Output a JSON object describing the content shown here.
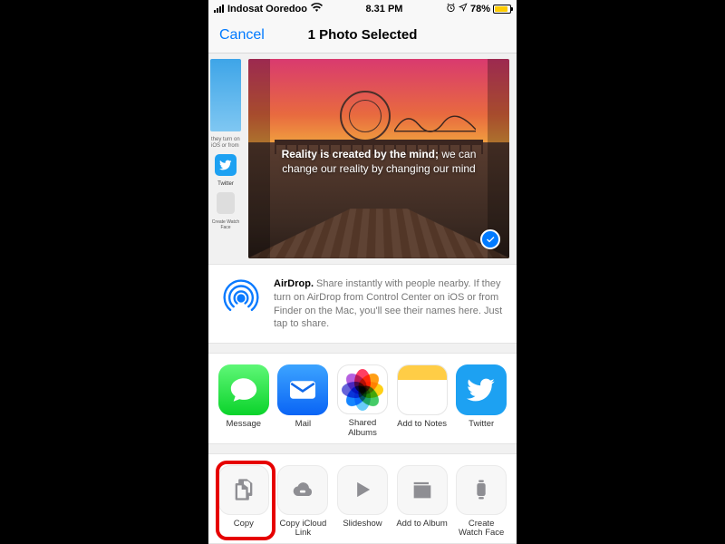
{
  "status": {
    "carrier": "Indosat Ooredoo",
    "time": "8.31 PM",
    "battery": "78%"
  },
  "nav": {
    "cancel": "Cancel",
    "title": "1 Photo Selected"
  },
  "preview": {
    "overlay_bold": "Reality is created by the mind;",
    "overlay_rest": " we can change our reality by changing our mind",
    "strip_twitter": "Twitter",
    "strip_watch": "Create Watch Face"
  },
  "airdrop": {
    "label": "AirDrop.",
    "desc": " Share instantly with people nearby. If they turn on AirDrop from Control Center on iOS or from Finder on the Mac, you'll see their names here. Just tap to share."
  },
  "apps": {
    "message": "Message",
    "mail": "Mail",
    "shared": "Shared Albums",
    "notes": "Add to Notes",
    "twitter": "Twitter"
  },
  "actions": {
    "copy": "Copy",
    "icloud": "Copy iCloud Link",
    "slideshow": "Slideshow",
    "album": "Add to Album",
    "watch": "Create Watch Face"
  }
}
